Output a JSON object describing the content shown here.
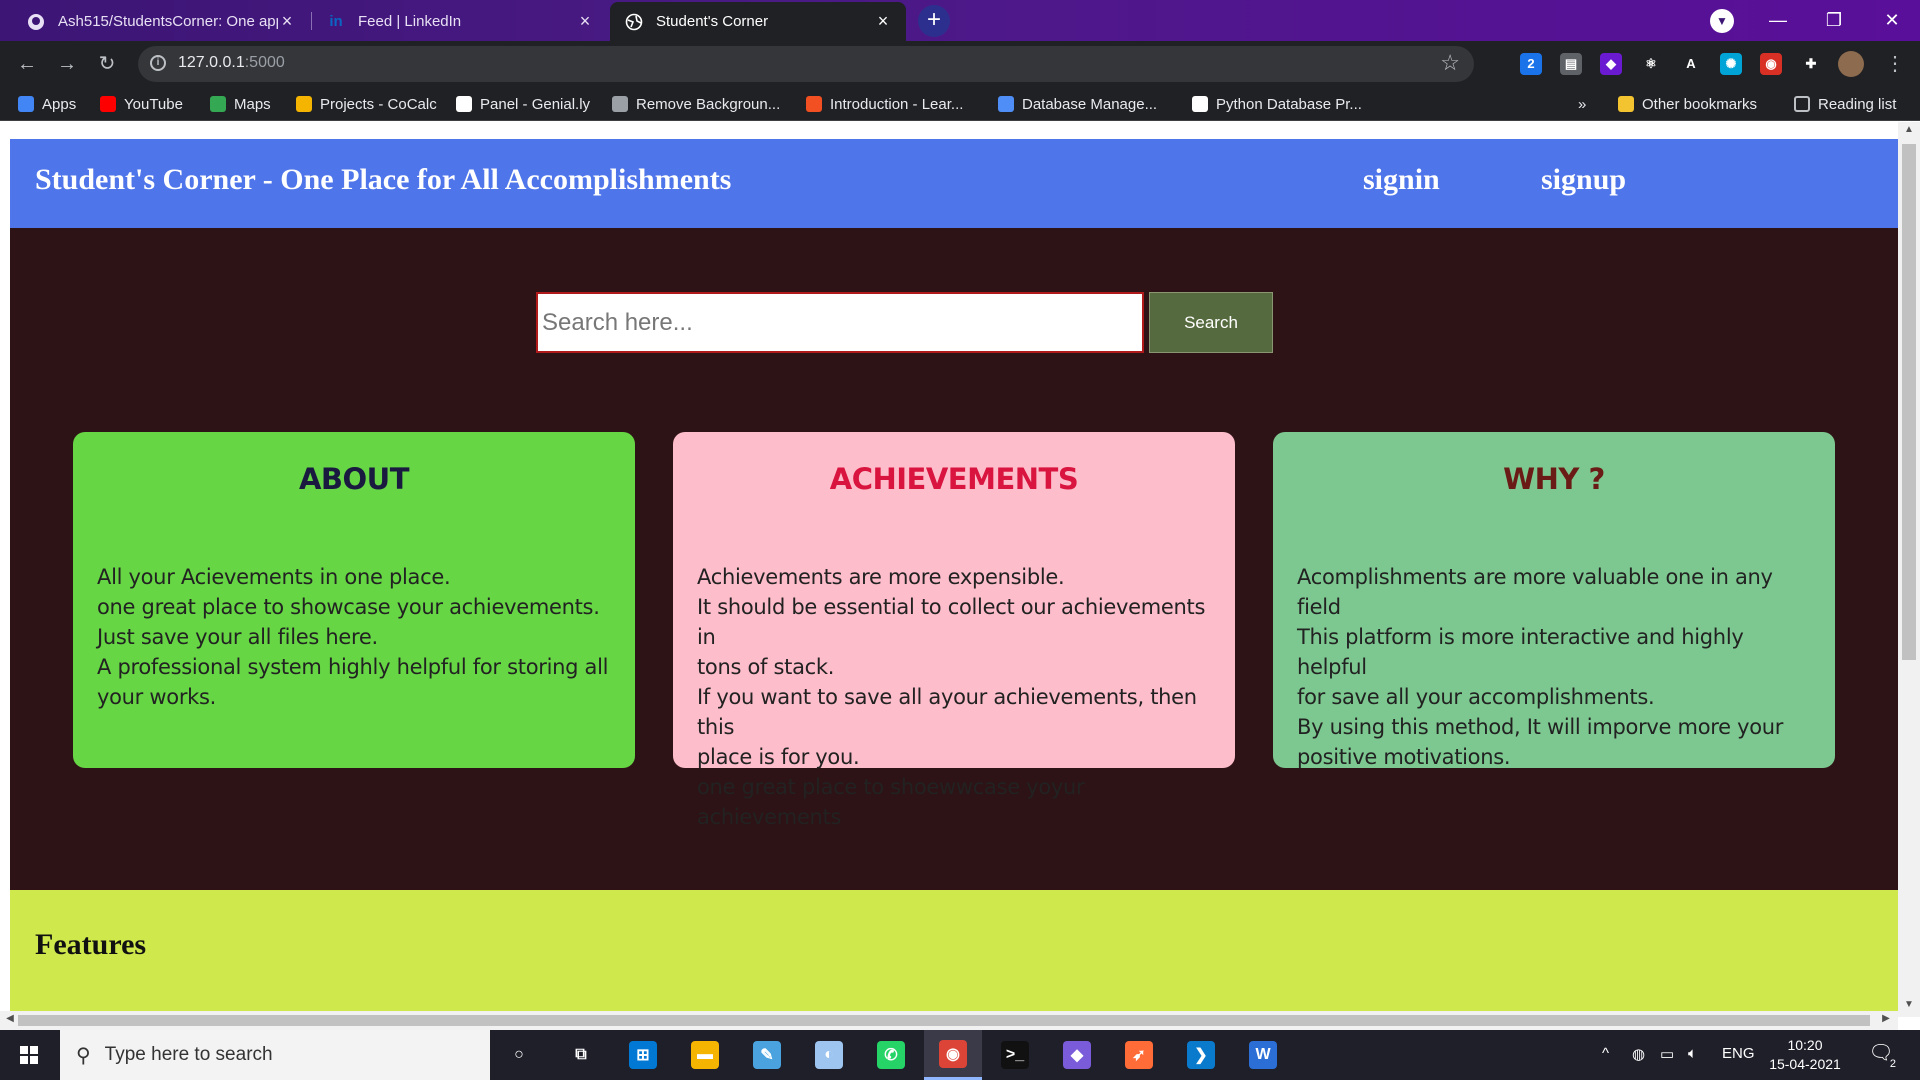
{
  "browser": {
    "tabs": [
      {
        "title": "Ash515/StudentsCorner: One app",
        "icon": "github-icon",
        "active": false
      },
      {
        "title": "Feed | LinkedIn",
        "icon": "linkedin-icon",
        "active": false
      },
      {
        "title": "Student's Corner",
        "icon": "globe-icon",
        "active": true
      }
    ],
    "new_tab_label": "+",
    "url_host": "127.0.0.1",
    "url_port": ":5000",
    "bookmarks": [
      {
        "label": "Apps",
        "icon": "apps-grid-icon"
      },
      {
        "label": "YouTube",
        "icon": "youtube-icon"
      },
      {
        "label": "Maps",
        "icon": "maps-icon"
      },
      {
        "label": "Projects - CoCalc",
        "icon": "cocalc-icon"
      },
      {
        "label": "Panel - Genial.ly",
        "icon": "genially-icon"
      },
      {
        "label": "Remove Backgroun...",
        "icon": "removebg-icon"
      },
      {
        "label": "Introduction - Lear...",
        "icon": "microsoft-icon"
      },
      {
        "label": "Database Manage...",
        "icon": "infinity-icon"
      },
      {
        "label": "Python Database Pr...",
        "icon": "python-db-icon"
      }
    ],
    "overflow_label": "»",
    "other_bookmarks": "Other bookmarks",
    "reading_list": "Reading list",
    "extensions": [
      {
        "name": "ext-2-icon",
        "label": "2",
        "color": "#1a73e8"
      },
      {
        "name": "ext-cards-icon",
        "label": "▤",
        "color": "#5f6368"
      },
      {
        "name": "ext-3-icon",
        "label": "◆",
        "color": "#6a1bd1"
      },
      {
        "name": "react-devtools-icon",
        "label": "⚛",
        "color": "#202124"
      },
      {
        "name": "ext-a-icon",
        "label": "A",
        "color": "#202124"
      },
      {
        "name": "ext-gear-icon",
        "label": "✺",
        "color": "#00a4d6"
      },
      {
        "name": "ext-chrome-icon",
        "label": "◉",
        "color": "#d93025"
      },
      {
        "name": "extensions-puzzle-icon",
        "label": "✚",
        "color": "#202124"
      }
    ]
  },
  "site": {
    "title": "Student's Corner - One Place for All Accomplishments",
    "nav": {
      "signin": "signin",
      "signup": "signup"
    },
    "search": {
      "placeholder": "Search here...",
      "button": "Search"
    },
    "cards": [
      {
        "heading": "ABOUT",
        "bg": "#66d644",
        "heading_color": "#1a1a40",
        "lines": [
          "All your Acievements in one place.",
          "one great place to showcase your achievements.",
          "Just save your all files here.",
          "A professional system highly helpful for storing all",
          "your works."
        ]
      },
      {
        "heading": "ACHIEVEMENTS",
        "bg": "#fdbdcb",
        "heading_color": "#d8143f",
        "lines": [
          "Achievements are more expensible.",
          "It should be essential to collect our achievements in",
          "tons of stack.",
          "If you want to save all ayour achievements, then this",
          "place is for you.",
          "one great place to shoewwcase yoyur achievements"
        ]
      },
      {
        "heading": "WHY ?",
        "bg": "#7dc890",
        "heading_color": "#6b1b16",
        "lines": [
          "Acomplishments are more valuable one in any field",
          "This platform is more interactive and highly helpful",
          "for save all your accomplishments.",
          "By using this method, It will imporve more your",
          "positive motivations."
        ]
      }
    ],
    "features_heading": "Features"
  },
  "taskbar": {
    "search_placeholder": "Type here to search",
    "apps": [
      {
        "name": "cortana-icon",
        "label": "○",
        "color": "transparent"
      },
      {
        "name": "task-view-icon",
        "label": "⧉",
        "color": "transparent"
      },
      {
        "name": "store-icon",
        "label": "⊞",
        "color": "#0078d4"
      },
      {
        "name": "file-explorer-icon",
        "label": "▬",
        "color": "#f4b400"
      },
      {
        "name": "notes-icon",
        "label": "✎",
        "color": "#4aa3df"
      },
      {
        "name": "paint-icon",
        "label": "◐",
        "color": "#9ec5f0"
      },
      {
        "name": "whatsapp-icon",
        "label": "✆",
        "color": "#25d366"
      },
      {
        "name": "chrome-icon",
        "label": "◉",
        "color": "#db4437"
      },
      {
        "name": "terminal-icon",
        "label": ">_",
        "color": "#111111"
      },
      {
        "name": "git-icon",
        "label": "◆",
        "color": "#7a5bd9"
      },
      {
        "name": "postman-icon",
        "label": "➶",
        "color": "#ff6c37"
      },
      {
        "name": "vscode-icon",
        "label": "❯",
        "color": "#0a7acc"
      },
      {
        "name": "word-icon",
        "label": "W",
        "color": "#2b6fd6"
      }
    ],
    "lang": "ENG",
    "time": "10:20",
    "date": "15-04-2021",
    "notif_count": "2"
  }
}
